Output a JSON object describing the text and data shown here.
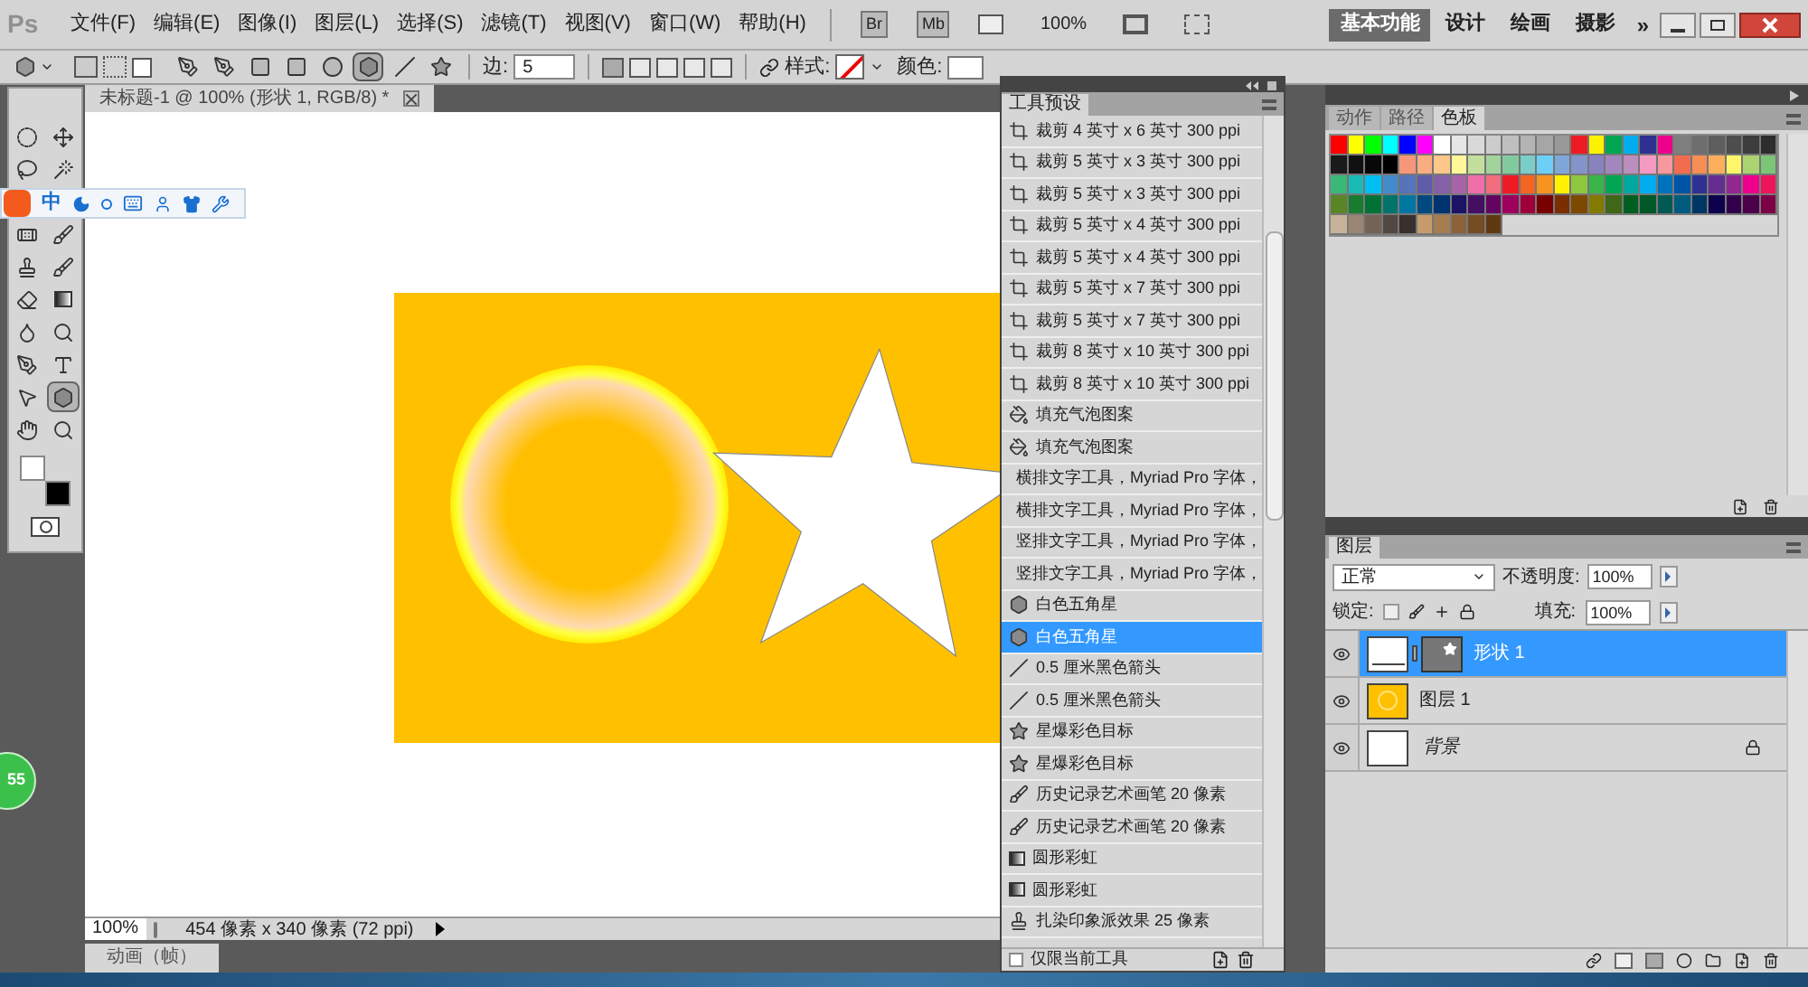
{
  "menu_bar": {
    "logo": "Ps",
    "menus": [
      "文件(F)",
      "编辑(E)",
      "图像(I)",
      "图层(L)",
      "选择(S)",
      "滤镜(T)",
      "视图(V)",
      "窗口(W)",
      "帮助(H)"
    ],
    "bridge": "Br",
    "mini_bridge": "Mb",
    "zoom": "100%",
    "workspaces": [
      {
        "label": "基本功能",
        "selected": true
      },
      {
        "label": "设计",
        "selected": false
      },
      {
        "label": "绘画",
        "selected": false
      },
      {
        "label": "摄影",
        "selected": false
      }
    ],
    "more": "»"
  },
  "options_bar": {
    "shape_tools": [
      {
        "kind": "pen",
        "selected": false
      },
      {
        "kind": "freepen",
        "selected": false
      },
      {
        "kind": "rect",
        "selected": false
      },
      {
        "kind": "roundrect",
        "selected": false
      },
      {
        "kind": "ellipse",
        "selected": false
      },
      {
        "kind": "polygon",
        "selected": true
      },
      {
        "kind": "line",
        "selected": false
      },
      {
        "kind": "custom",
        "selected": false
      }
    ],
    "sides_label": "边:",
    "sides_value": "5",
    "style_label": "样式:",
    "color_label": "颜色:"
  },
  "toolbox": [
    {
      "kind": "marquee",
      "selected": false
    },
    {
      "kind": "move",
      "selected": false
    },
    {
      "kind": "lasso",
      "selected": false
    },
    {
      "kind": "wand",
      "selected": false
    },
    {
      "kind": "heal",
      "selected": false
    },
    {
      "kind": "brush",
      "selected": false
    },
    {
      "kind": "stamp",
      "selected": false
    },
    {
      "kind": "history",
      "selected": false
    },
    {
      "kind": "eraser",
      "selected": false
    },
    {
      "kind": "gradient",
      "selected": false
    },
    {
      "kind": "blur",
      "selected": false
    },
    {
      "kind": "dodge",
      "selected": false
    },
    {
      "kind": "pen",
      "selected": false
    },
    {
      "kind": "type",
      "selected": false
    },
    {
      "kind": "pathselect",
      "selected": false
    },
    {
      "kind": "shape",
      "selected": true
    },
    {
      "kind": "hand",
      "selected": false
    },
    {
      "kind": "zoom",
      "selected": false
    }
  ],
  "ime_bar": {
    "mode": "中"
  },
  "floating_badge": "55",
  "document": {
    "tab_title": "未标题-1 @ 100% (形状 1, RGB/8) *",
    "zoom": "100%",
    "info": "454 像素 x 340 像素 (72 ppi)"
  },
  "animation_panel": {
    "tab": "动画（帧）"
  },
  "tool_presets": {
    "tab": "工具预设",
    "items": [
      {
        "kind": "crop",
        "label": "裁剪 4 英寸 x 6 英寸 300 ppi",
        "selected": false
      },
      {
        "kind": "crop",
        "label": "裁剪 5 英寸 x 3 英寸 300 ppi",
        "selected": false
      },
      {
        "kind": "crop",
        "label": "裁剪 5 英寸 x 3 英寸 300 ppi",
        "selected": false
      },
      {
        "kind": "crop",
        "label": "裁剪 5 英寸 x 4 英寸 300 ppi",
        "selected": false
      },
      {
        "kind": "crop",
        "label": "裁剪 5 英寸 x 4 英寸 300 ppi",
        "selected": false
      },
      {
        "kind": "crop",
        "label": "裁剪 5 英寸 x 7 英寸 300 ppi",
        "selected": false
      },
      {
        "kind": "crop",
        "label": "裁剪 5 英寸 x 7 英寸 300 ppi",
        "selected": false
      },
      {
        "kind": "crop",
        "label": "裁剪 8 英寸 x 10 英寸 300 ppi",
        "selected": false
      },
      {
        "kind": "crop",
        "label": "裁剪 8 英寸 x 10 英寸 300 ppi",
        "selected": false
      },
      {
        "kind": "fill",
        "label": "填充气泡图案",
        "selected": false
      },
      {
        "kind": "fill",
        "label": "填充气泡图案",
        "selected": false
      },
      {
        "kind": "htext",
        "label": "横排文字工具，Myriad Pro 字体，",
        "selected": false
      },
      {
        "kind": "htext",
        "label": "横排文字工具，Myriad Pro 字体，",
        "selected": false
      },
      {
        "kind": "vtext",
        "label": "竖排文字工具，Myriad Pro 字体，",
        "selected": false
      },
      {
        "kind": "vtext",
        "label": "竖排文字工具，Myriad Pro 字体，",
        "selected": false
      },
      {
        "kind": "shape",
        "label": "白色五角星",
        "selected": false
      },
      {
        "kind": "shape",
        "label": "白色五角星",
        "selected": true
      },
      {
        "kind": "line",
        "label": "0.5 厘米黑色箭头",
        "selected": false
      },
      {
        "kind": "line",
        "label": "0.5 厘米黑色箭头",
        "selected": false
      },
      {
        "kind": "starburst",
        "label": "星爆彩色目标",
        "selected": false
      },
      {
        "kind": "starburst",
        "label": "星爆彩色目标",
        "selected": false
      },
      {
        "kind": "history",
        "label": "历史记录艺术画笔 20 像素",
        "selected": false
      },
      {
        "kind": "history",
        "label": "历史记录艺术画笔 20 像素",
        "selected": false
      },
      {
        "kind": "gradient",
        "label": "圆形彩虹",
        "selected": false
      },
      {
        "kind": "gradient",
        "label": "圆形彩虹",
        "selected": false
      },
      {
        "kind": "stamp",
        "label": "扎染印象派效果 25 像素",
        "selected": false
      }
    ],
    "current_only_label": "仅限当前工具",
    "current_only_checked": false
  },
  "swatch_panel": {
    "tabs": [
      {
        "label": "动作",
        "selected": false
      },
      {
        "label": "路径",
        "selected": false
      },
      {
        "label": "色板",
        "selected": true
      }
    ],
    "swatches": [
      {
        "color": "#ff0000"
      },
      {
        "color": "#ffff00"
      },
      {
        "color": "#00ff00"
      },
      {
        "color": "#00ffff"
      },
      {
        "color": "#0000ff"
      },
      {
        "color": "#ff00ff"
      },
      {
        "color": "#ffffff"
      },
      {
        "color": "#e6e6e6"
      },
      {
        "color": "#d9d9d9"
      },
      {
        "color": "#cccccc"
      },
      {
        "color": "#bfbfbf"
      },
      {
        "color": "#b3b3b3"
      },
      {
        "color": "#a6a6a6"
      },
      {
        "color": "#999999"
      },
      {
        "color": "#ed1c24"
      },
      {
        "color": "#fff200"
      },
      {
        "color": "#00a651"
      },
      {
        "color": "#00aeef"
      },
      {
        "color": "#2e3192"
      },
      {
        "color": "#ec008c"
      },
      {
        "color": "#7f7f7f"
      },
      {
        "color": "#6e6e6e"
      },
      {
        "color": "#5e5e5e"
      },
      {
        "color": "#4d4d4d"
      },
      {
        "color": "#3d3d3d"
      },
      {
        "color": "#2d2d2d"
      },
      {
        "color": "#1a1a1a"
      },
      {
        "color": "#111111"
      },
      {
        "color": "#080808"
      },
      {
        "color": "#000000"
      },
      {
        "color": "#f7977a"
      },
      {
        "color": "#f9ad81"
      },
      {
        "color": "#fdc68a"
      },
      {
        "color": "#fff79a"
      },
      {
        "color": "#c4df9b"
      },
      {
        "color": "#a3d39c"
      },
      {
        "color": "#82ca9d"
      },
      {
        "color": "#7bcdc8"
      },
      {
        "color": "#6ecff6"
      },
      {
        "color": "#7ea7d8"
      },
      {
        "color": "#8493ca"
      },
      {
        "color": "#8882be"
      },
      {
        "color": "#a187be"
      },
      {
        "color": "#bc8dbf"
      },
      {
        "color": "#f49ac2"
      },
      {
        "color": "#f6989d"
      },
      {
        "color": "#f26c4f"
      },
      {
        "color": "#f68e55"
      },
      {
        "color": "#fbaf5d"
      },
      {
        "color": "#fff568"
      },
      {
        "color": "#acd372"
      },
      {
        "color": "#7cc576"
      },
      {
        "color": "#3bb878"
      },
      {
        "color": "#1abbb4"
      },
      {
        "color": "#00bff3"
      },
      {
        "color": "#438ccb"
      },
      {
        "color": "#5574b9"
      },
      {
        "color": "#605ca8"
      },
      {
        "color": "#855fa8"
      },
      {
        "color": "#a763a8"
      },
      {
        "color": "#f06eaa"
      },
      {
        "color": "#f26d7d"
      },
      {
        "color": "#ed1c24"
      },
      {
        "color": "#f26522"
      },
      {
        "color": "#f7941d"
      },
      {
        "color": "#fff200"
      },
      {
        "color": "#8dc73f"
      },
      {
        "color": "#39b54a"
      },
      {
        "color": "#00a651"
      },
      {
        "color": "#00a99d"
      },
      {
        "color": "#00aeef"
      },
      {
        "color": "#0072bc"
      },
      {
        "color": "#0054a6"
      },
      {
        "color": "#2e3192"
      },
      {
        "color": "#662d91"
      },
      {
        "color": "#92278f"
      },
      {
        "color": "#ec008c"
      },
      {
        "color": "#ed145b"
      },
      {
        "color": "#598527"
      },
      {
        "color": "#197b30"
      },
      {
        "color": "#007236"
      },
      {
        "color": "#00746b"
      },
      {
        "color": "#0076a3"
      },
      {
        "color": "#004a80"
      },
      {
        "color": "#003471"
      },
      {
        "color": "#1b1464"
      },
      {
        "color": "#440e62"
      },
      {
        "color": "#630460"
      },
      {
        "color": "#9e005d"
      },
      {
        "color": "#9e0039"
      },
      {
        "color": "#790000"
      },
      {
        "color": "#7b2e00"
      },
      {
        "color": "#7d4900"
      },
      {
        "color": "#827b00"
      },
      {
        "color": "#406618"
      },
      {
        "color": "#005e20"
      },
      {
        "color": "#005826"
      },
      {
        "color": "#005952"
      },
      {
        "color": "#005b7f"
      },
      {
        "color": "#003663"
      },
      {
        "color": "#0d004c"
      },
      {
        "color": "#32004b"
      },
      {
        "color": "#4b0049"
      },
      {
        "color": "#7b0046"
      },
      {
        "color": "#c7b299"
      },
      {
        "color": "#998675"
      },
      {
        "color": "#736357"
      },
      {
        "color": "#534741"
      },
      {
        "color": "#37302d"
      },
      {
        "color": "#c69c6d"
      },
      {
        "color": "#a67c52"
      },
      {
        "color": "#8c6239"
      },
      {
        "color": "#754c24"
      },
      {
        "color": "#603913"
      }
    ]
  },
  "layers_panel": {
    "tab": "图层",
    "blend_mode": "正常",
    "opacity_label": "不透明度:",
    "opacity": "100%",
    "lock_label": "锁定:",
    "fill_label": "填充:",
    "fill": "100%",
    "layers": [
      {
        "kind": "shape",
        "name": "形状 1",
        "selected": true,
        "visible": true
      },
      {
        "kind": "raster",
        "name": "图层 1",
        "selected": false,
        "visible": true
      },
      {
        "kind": "background",
        "name": "背景",
        "selected": false,
        "visible": true
      }
    ]
  }
}
